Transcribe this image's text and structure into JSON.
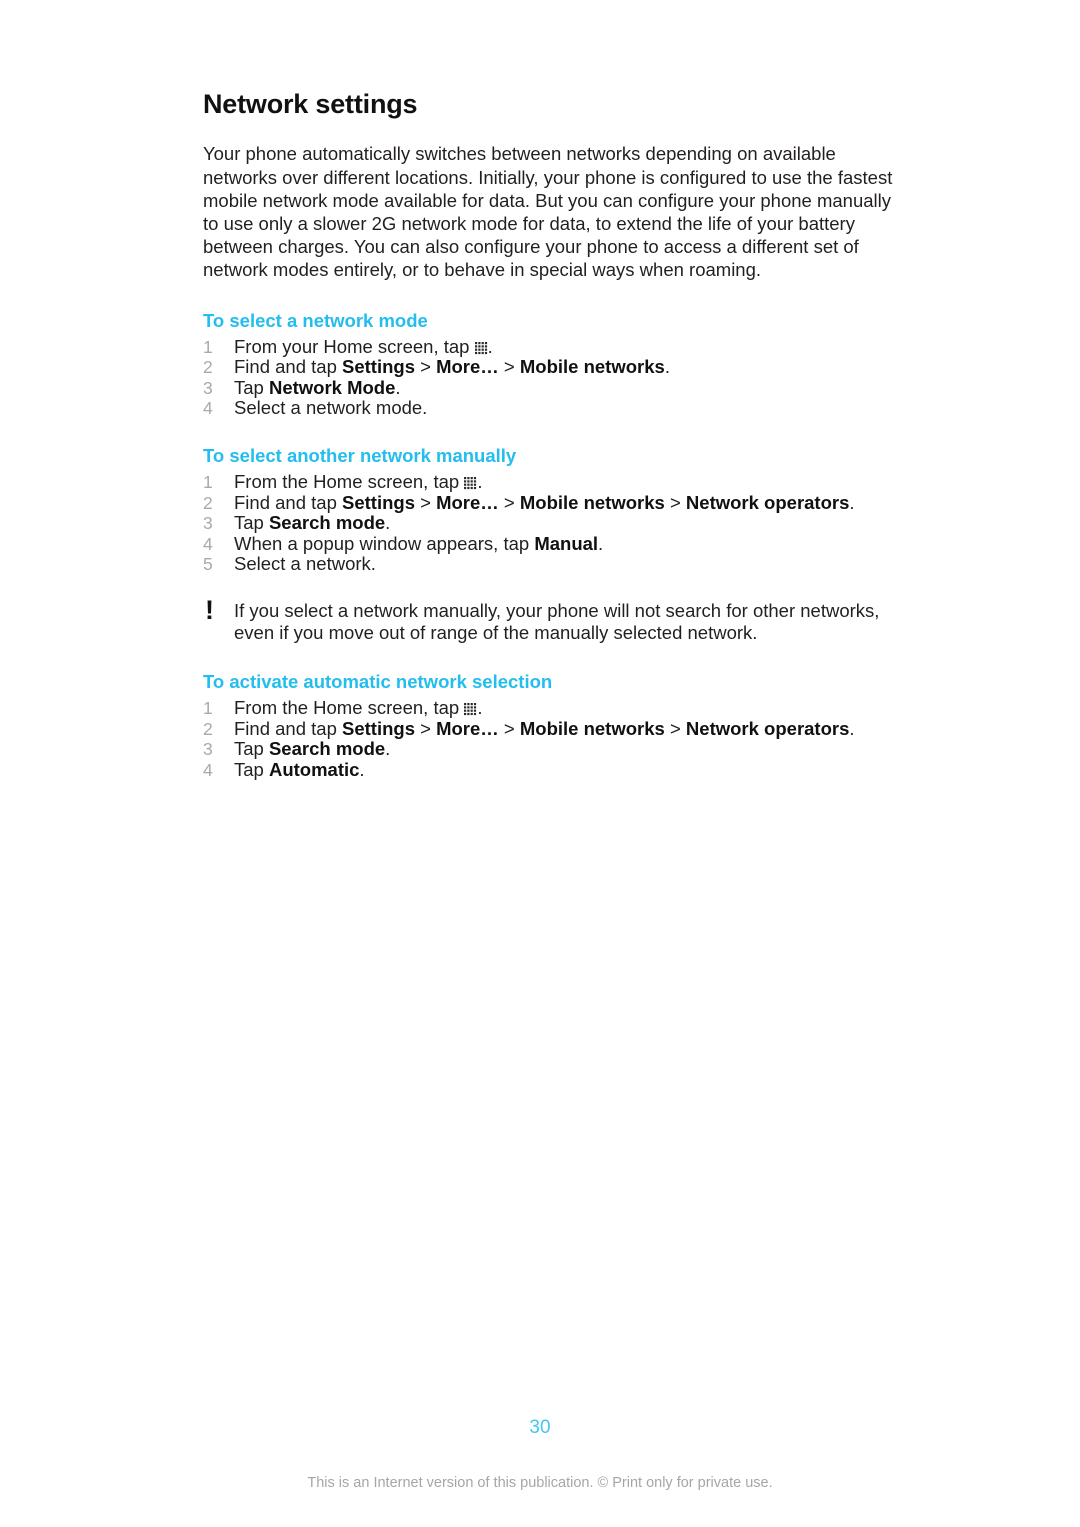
{
  "document": {
    "title": "Network settings",
    "intro": "Your phone automatically switches between networks depending on available networks over different locations. Initially, your phone is configured to use the fastest mobile network mode available for data. But you can configure your phone manually to use only a slower 2G network mode for data, to extend the life of your battery between charges. You can also configure your phone to access a different set of network modes entirely, or to behave in special ways when roaming."
  },
  "colors": {
    "accent_cyan": "#23bdee",
    "step_number_gray": "#a9a9a9",
    "body_text": "#231f20",
    "footer_gray": "#a6a6a6",
    "page_number_cyan": "#45c6ef"
  },
  "sections": [
    {
      "title": "To select a network mode",
      "steps": [
        {
          "number": "1",
          "parts": [
            {
              "type": "text",
              "value": "From your Home screen, tap "
            },
            {
              "type": "icon",
              "value": "app-grid-icon"
            },
            {
              "type": "text",
              "value": "."
            }
          ]
        },
        {
          "number": "2",
          "parts": [
            {
              "type": "text",
              "value": "Find and tap "
            },
            {
              "type": "bold",
              "value": "Settings"
            },
            {
              "type": "text",
              "value": " > "
            },
            {
              "type": "bold",
              "value": "More…"
            },
            {
              "type": "text",
              "value": " > "
            },
            {
              "type": "bold",
              "value": "Mobile networks"
            },
            {
              "type": "text",
              "value": "."
            }
          ]
        },
        {
          "number": "3",
          "parts": [
            {
              "type": "text",
              "value": "Tap "
            },
            {
              "type": "bold",
              "value": "Network Mode"
            },
            {
              "type": "text",
              "value": "."
            }
          ]
        },
        {
          "number": "4",
          "parts": [
            {
              "type": "text",
              "value": "Select a network mode."
            }
          ]
        }
      ]
    },
    {
      "title": "To select another network manually",
      "steps": [
        {
          "number": "1",
          "parts": [
            {
              "type": "text",
              "value": "From the Home screen, tap "
            },
            {
              "type": "icon",
              "value": "app-grid-icon"
            },
            {
              "type": "text",
              "value": "."
            }
          ]
        },
        {
          "number": "2",
          "parts": [
            {
              "type": "text",
              "value": "Find and tap "
            },
            {
              "type": "bold",
              "value": "Settings"
            },
            {
              "type": "text",
              "value": " > "
            },
            {
              "type": "bold",
              "value": "More…"
            },
            {
              "type": "text",
              "value": " > "
            },
            {
              "type": "bold",
              "value": "Mobile networks"
            },
            {
              "type": "text",
              "value": " > "
            },
            {
              "type": "bold",
              "value": "Network operators"
            },
            {
              "type": "text",
              "value": "."
            }
          ]
        },
        {
          "number": "3",
          "parts": [
            {
              "type": "text",
              "value": "Tap "
            },
            {
              "type": "bold",
              "value": "Search mode"
            },
            {
              "type": "text",
              "value": "."
            }
          ]
        },
        {
          "number": "4",
          "parts": [
            {
              "type": "text",
              "value": "When a popup window appears, tap "
            },
            {
              "type": "bold",
              "value": "Manual"
            },
            {
              "type": "text",
              "value": "."
            }
          ]
        },
        {
          "number": "5",
          "parts": [
            {
              "type": "text",
              "value": "Select a network."
            }
          ]
        }
      ],
      "note": {
        "icon": "exclamation-icon",
        "text": "If you select a network manually, your phone will not search for other networks, even if you move out of range of the manually selected network."
      }
    },
    {
      "title": "To activate automatic network selection",
      "steps": [
        {
          "number": "1",
          "parts": [
            {
              "type": "text",
              "value": "From the Home screen, tap "
            },
            {
              "type": "icon",
              "value": "app-grid-icon"
            },
            {
              "type": "text",
              "value": "."
            }
          ]
        },
        {
          "number": "2",
          "parts": [
            {
              "type": "text",
              "value": "Find and tap "
            },
            {
              "type": "bold",
              "value": "Settings"
            },
            {
              "type": "text",
              "value": " > "
            },
            {
              "type": "bold",
              "value": "More…"
            },
            {
              "type": "text",
              "value": " > "
            },
            {
              "type": "bold",
              "value": "Mobile networks"
            },
            {
              "type": "text",
              "value": " > "
            },
            {
              "type": "bold",
              "value": "Network operators"
            },
            {
              "type": "text",
              "value": "."
            }
          ]
        },
        {
          "number": "3",
          "parts": [
            {
              "type": "text",
              "value": "Tap "
            },
            {
              "type": "bold",
              "value": "Search mode"
            },
            {
              "type": "text",
              "value": "."
            }
          ]
        },
        {
          "number": "4",
          "parts": [
            {
              "type": "text",
              "value": "Tap "
            },
            {
              "type": "bold",
              "value": "Automatic"
            },
            {
              "type": "text",
              "value": "."
            }
          ]
        }
      ]
    }
  ],
  "footer": {
    "page_number": "30",
    "notice": "This is an Internet version of this publication. © Print only for private use."
  }
}
